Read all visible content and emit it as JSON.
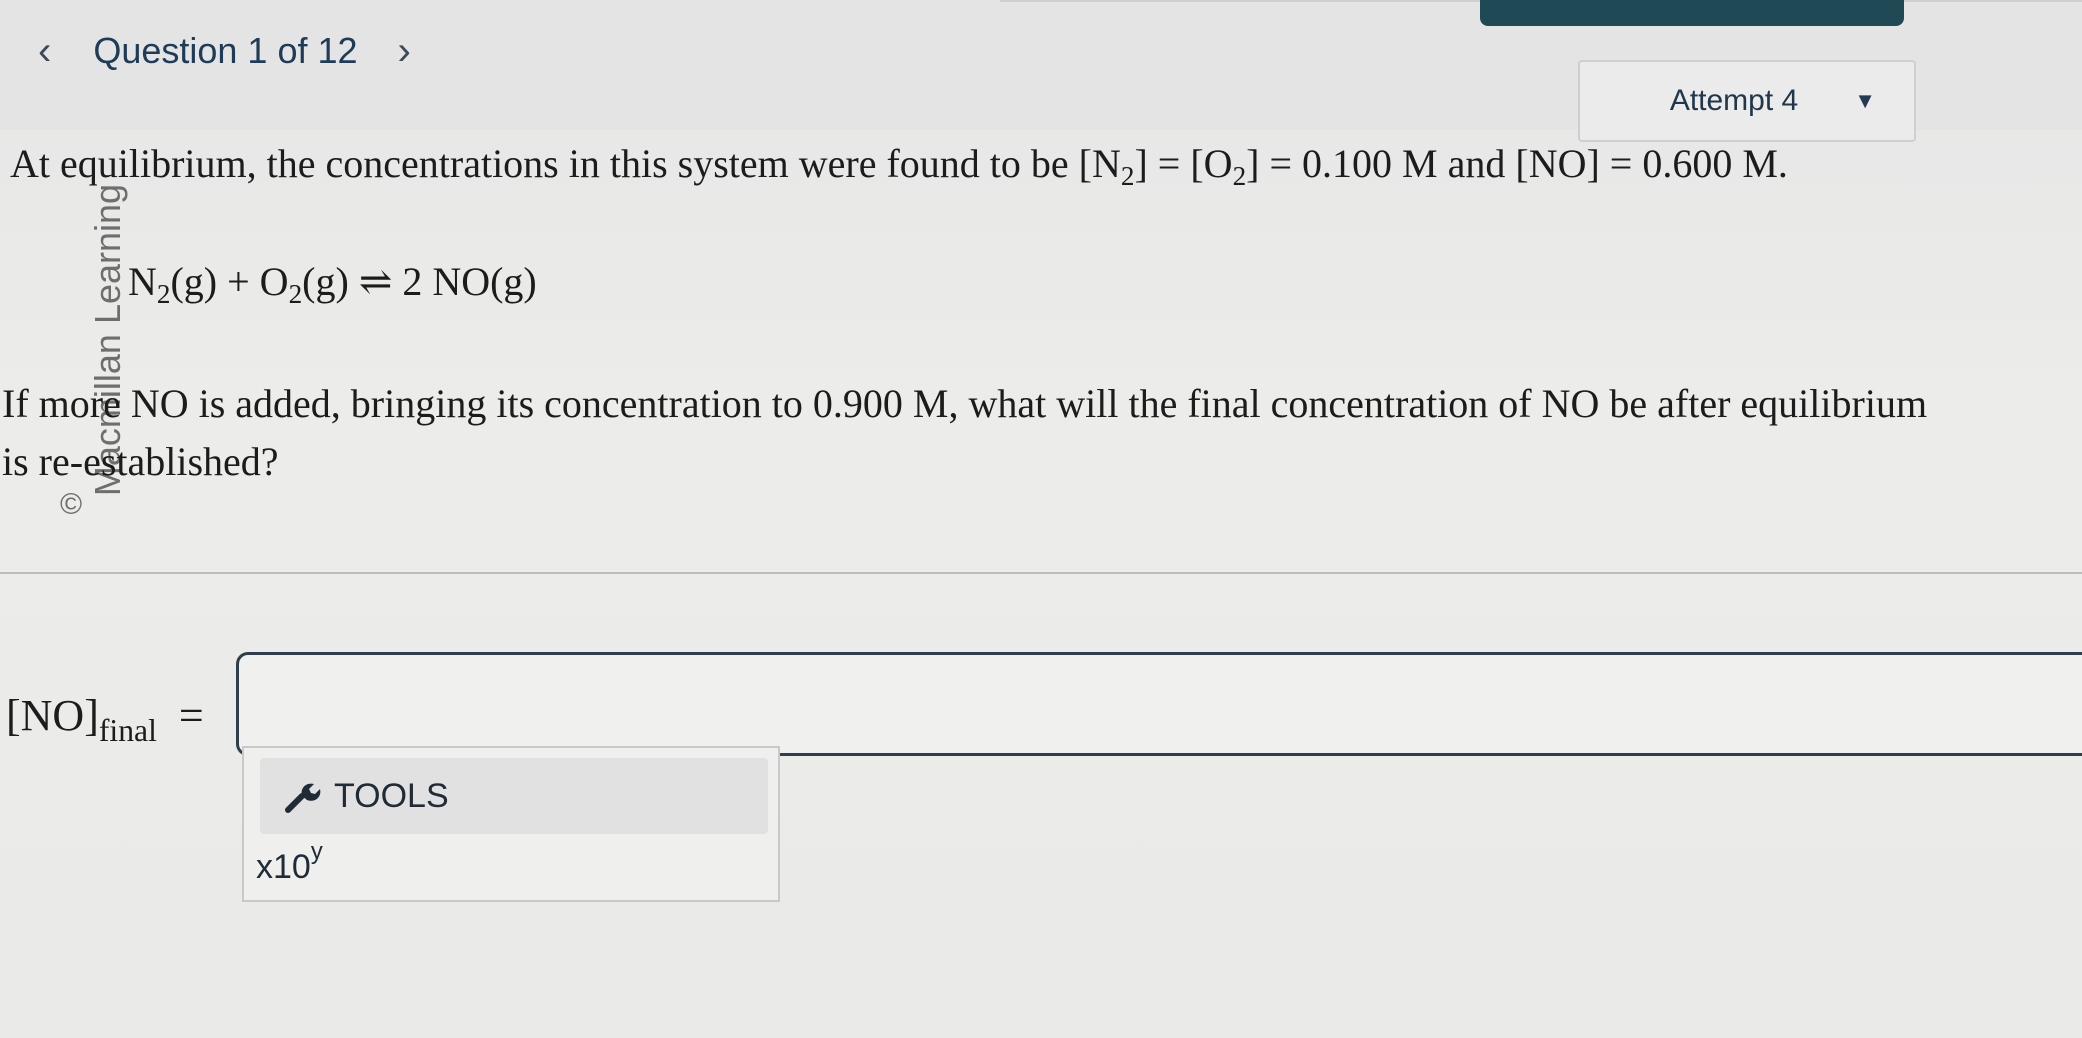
{
  "nav": {
    "prev_icon": "‹",
    "label": "Question 1 of 12",
    "next_icon": "›"
  },
  "attempt": {
    "label": "Attempt 4",
    "caret": "▼"
  },
  "question": {
    "line1_text": "At equilibrium, the concentrations in this system were found to be [N",
    "line1_sub1": "2",
    "line1_mid": "] = [O",
    "line1_sub2": "2",
    "line1_end": "] = 0.100 M and [NO] = 0.600 M.",
    "equation": {
      "part1": "N",
      "sub1": "2",
      "part2": "(g) + O",
      "sub2": "2",
      "part3": "(g) ⇌ 2 NO(g)"
    },
    "line2": "If more NO is added, bringing its concentration to 0.900 M, what will the final concentration of NO be after equilibrium",
    "line3": "is re-established?"
  },
  "watermark": {
    "text": "Macmillan Learning",
    "copyright_symbol": "©"
  },
  "answer": {
    "label_main": "[NO]",
    "label_sub": "final",
    "equals": "=",
    "value": ""
  },
  "tools": {
    "label": "TOOLS",
    "icon": "wrench-icon",
    "sci_base": "x10",
    "sci_exp": "y"
  },
  "colors": {
    "nav_text": "#1e3b58",
    "input_border": "#2f3e4c",
    "corner_button": "#1f4a55"
  }
}
